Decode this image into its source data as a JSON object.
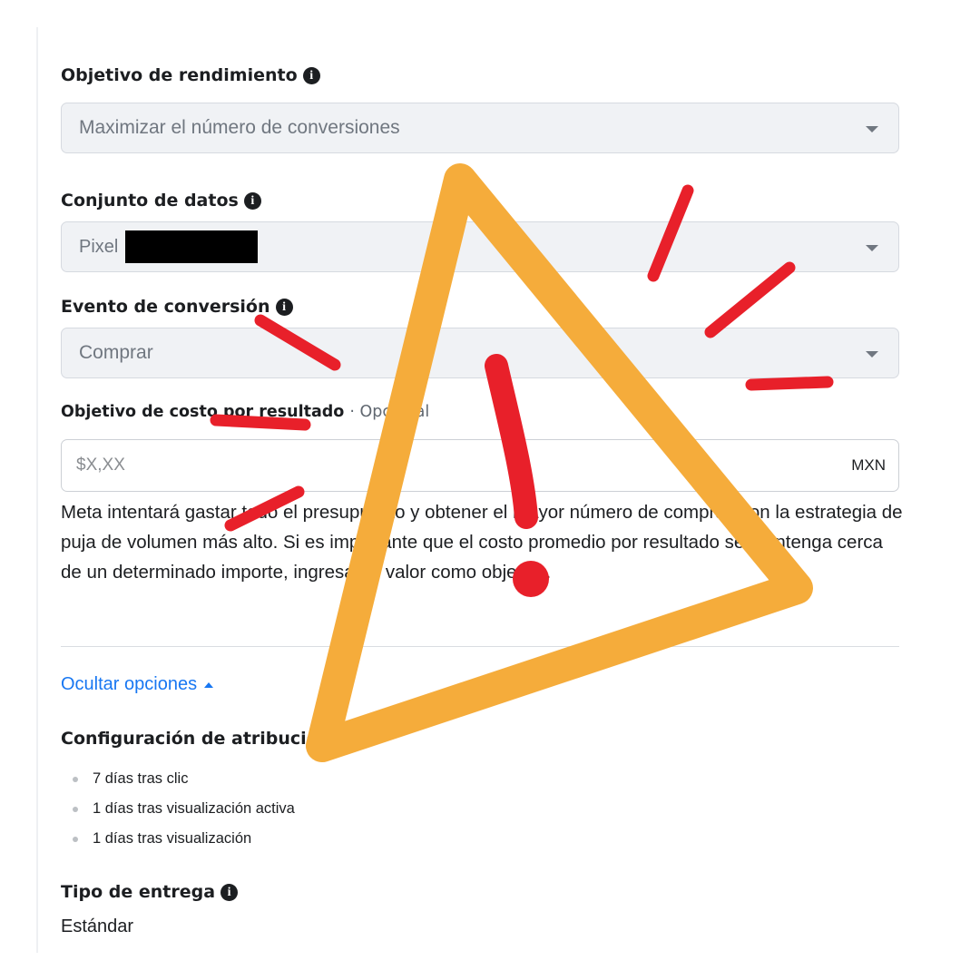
{
  "performance_goal": {
    "label": "Objetivo de rendimiento",
    "value": "Maximizar el número de conversiones"
  },
  "dataset": {
    "label": "Conjunto de datos",
    "value": "Pixel"
  },
  "conversion_event": {
    "label": "Evento de conversión",
    "value": "Comprar"
  },
  "cost_goal": {
    "label": "Objetivo de costo por resultado",
    "optional": "· Opcional",
    "placeholder": "$X,XX",
    "currency": "MXN",
    "help": "Meta intentará gastar todo el presupuesto y obtener el mayor número de compras con la estrategia de puja de volumen más alto. Si es importante que el costo promedio por resultado se mantenga cerca de un determinado importe, ingresa un valor como objetivo."
  },
  "toggle_options": {
    "label": "Ocultar opciones"
  },
  "attribution": {
    "label": "Configuración de atribución",
    "items": [
      "7 días tras clic",
      "1 días tras visualización activa",
      "1 días tras visualización"
    ]
  },
  "delivery": {
    "label": "Tipo de entrega",
    "value": "Estándar"
  },
  "colors": {
    "warning_triangle": "#f5ac3b",
    "alert_marks": "#e8202a",
    "link": "#1877f2"
  },
  "icons": [
    "info-icon",
    "dropdown-caret-icon",
    "chevron-up-icon",
    "warning-triangle-icon",
    "exclamation-icon"
  ]
}
